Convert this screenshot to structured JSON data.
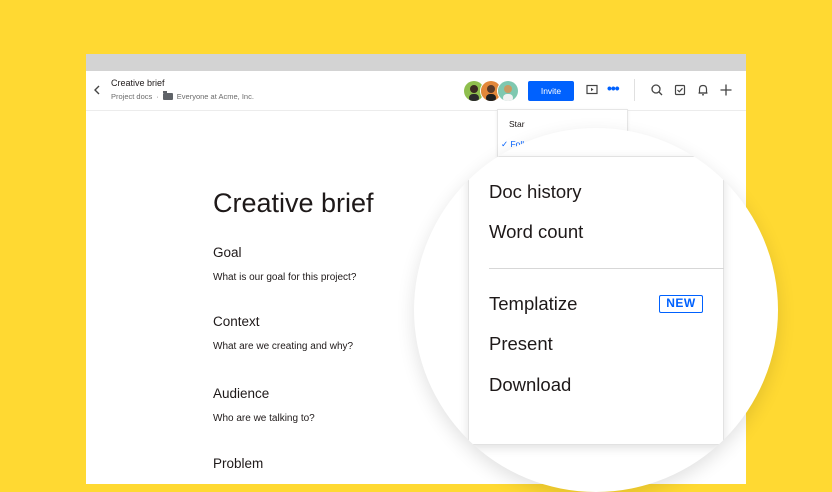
{
  "header": {
    "title": "Creative brief",
    "breadcrumb_folder": "Project docs",
    "breadcrumb_sep": "·",
    "breadcrumb_team": "Everyone at Acme, Inc.",
    "invite_label": "Invite",
    "more_label": "•••"
  },
  "overflow_menu": {
    "star_label": "Star",
    "follow_label": "✓ Follo"
  },
  "document": {
    "title": "Creative brief",
    "sections": [
      {
        "label": "Goal",
        "question": "What is our goal for this project?"
      },
      {
        "label": "Context",
        "question": "What are we creating and why?"
      },
      {
        "label": "Audience",
        "question": "Who are we talking to?"
      },
      {
        "label": "Problem",
        "question": ""
      }
    ]
  },
  "magnified_menu": {
    "doc_history": "Doc history",
    "word_count": "Word count",
    "templatize": "Templatize",
    "new_badge": "NEW",
    "present": "Present",
    "download": "Download"
  },
  "colors": {
    "background": "#FFD932",
    "accent": "#0061fe",
    "text": "#1e1919"
  },
  "icons": [
    "chevron-left-icon",
    "folder-icon",
    "present-icon",
    "search-icon",
    "checkbox-icon",
    "bell-icon",
    "plus-icon"
  ]
}
